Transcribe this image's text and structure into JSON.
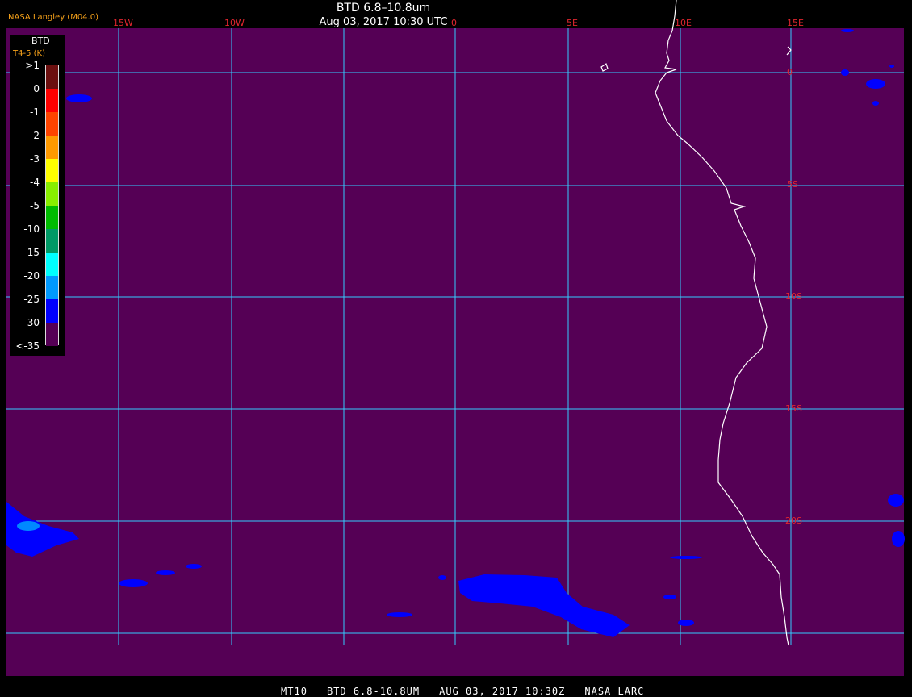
{
  "header": {
    "credit": "NASA Langley (M04.0)",
    "title": "BTD 6.8–10.8um",
    "datetime": "Aug 03, 2017 10:30 UTC"
  },
  "legend": {
    "title": "BTD",
    "unit": "T4-5 (K)",
    "labels": [
      ">1",
      "0",
      "-1",
      "-2",
      "-3",
      "-4",
      "-5",
      "-10",
      "-15",
      "-20",
      "-25",
      "-30",
      "<-35"
    ],
    "colors": [
      "#6b0f0f",
      "#ff0000",
      "#ff4400",
      "#ff9900",
      "#ffff00",
      "#88ee00",
      "#00bb00",
      "#009966",
      "#00ffff",
      "#0099ff",
      "#0000ff",
      "#550055"
    ]
  },
  "map": {
    "background_color": "#550055",
    "grid_color": "#33ccff",
    "coastline_color": "#ffffff",
    "cloud_color": "#0000ff",
    "longitude_labels": [
      "15W",
      "10W",
      "0",
      "5E",
      "10E",
      "15E"
    ],
    "latitude_labels": [
      "0",
      "5S",
      "10S",
      "15S",
      "20S"
    ]
  },
  "footer": {
    "items": [
      "MT10",
      "BTD 6.8-10.8UM",
      "AUG 03, 2017 10:30Z",
      "NASA LARC"
    ]
  }
}
